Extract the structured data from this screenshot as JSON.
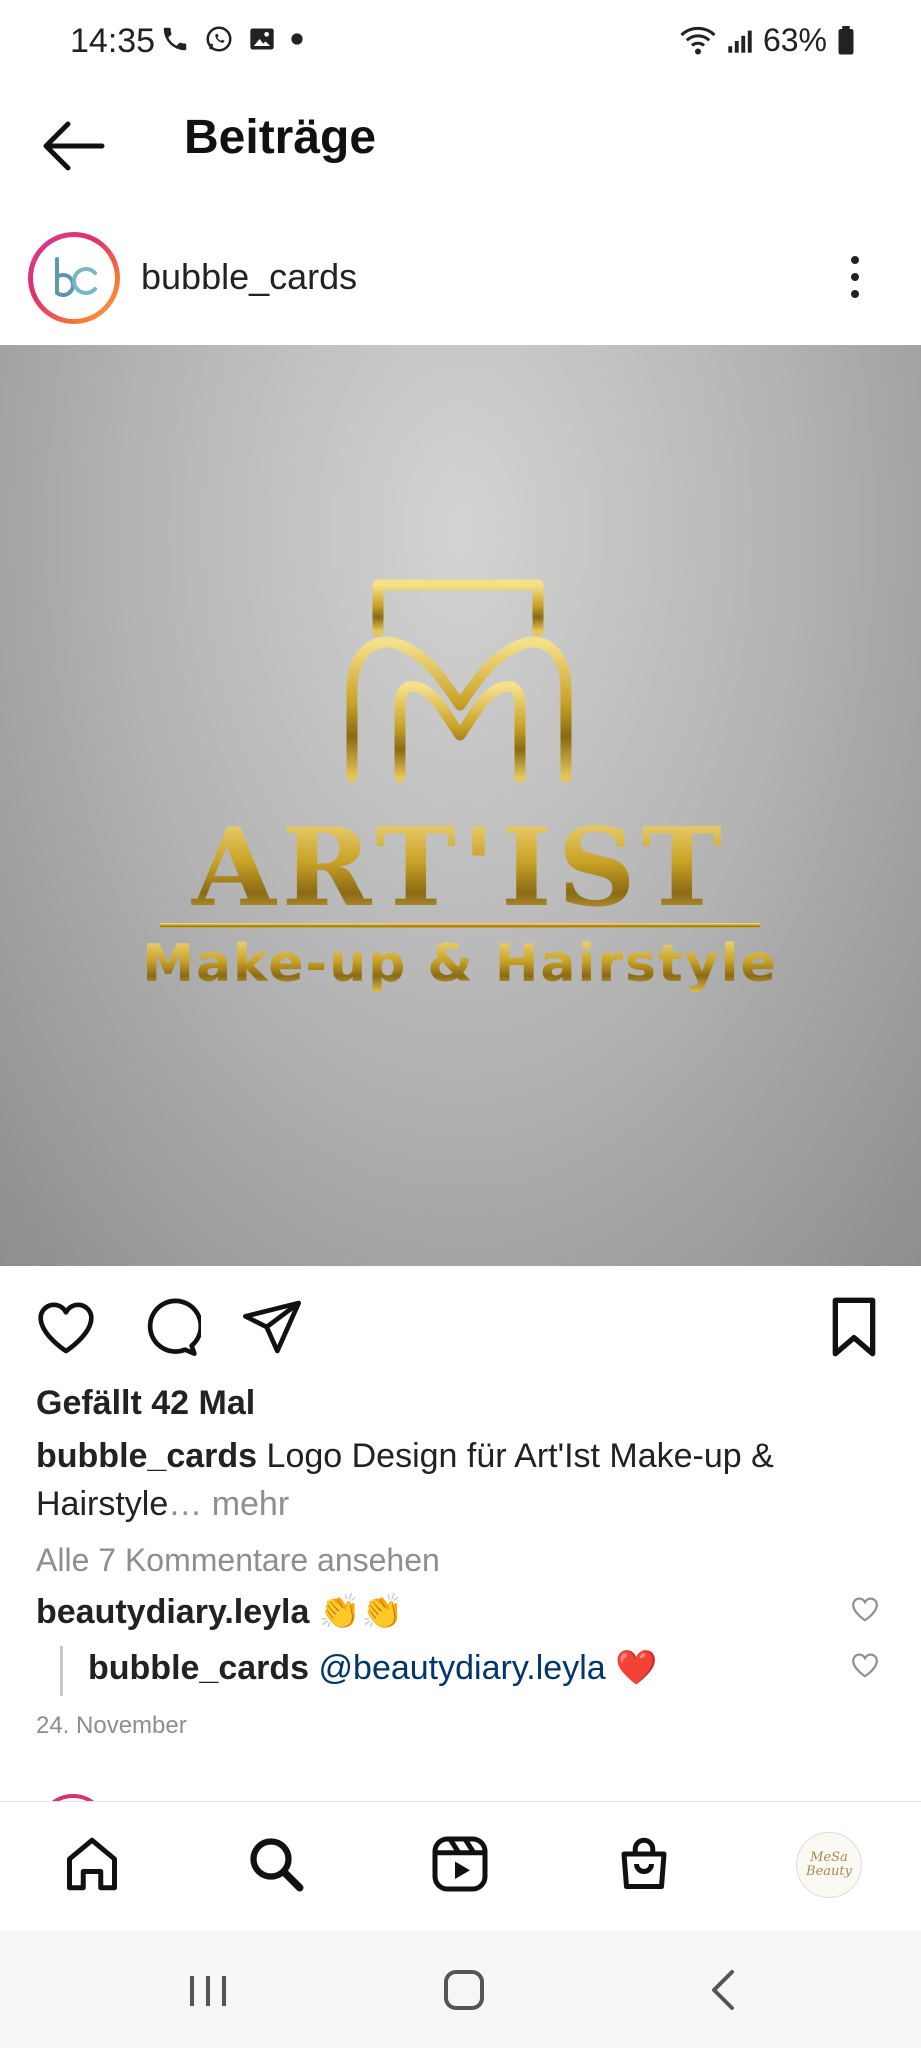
{
  "status_bar": {
    "time": "14:35",
    "battery": "63%"
  },
  "header": {
    "title": "Beiträge"
  },
  "post": {
    "username": "bubble_cards",
    "avatar_initials": "bc",
    "image_logo": {
      "brand": "ART'IST",
      "tagline": "Make-up & Hairstyle",
      "metal_color": "#c9a227"
    },
    "likes": "Gefällt 42 Mal",
    "caption_user": "bubble_cards",
    "caption_text": "Logo Design für Art'Ist Make-up & Hairstyle",
    "caption_more_ellipsis": "…",
    "caption_more": "mehr",
    "view_comments": "Alle 7 Kommentare ansehen",
    "comments": [
      {
        "user": "beautydiary.leyla",
        "text": "👏👏"
      }
    ],
    "reply": {
      "user": "bubble_cards",
      "mention": "@beautydiary.leyla",
      "text": "❤️"
    },
    "date": "24. November"
  },
  "bottom_nav": {
    "items": [
      "home-icon",
      "search-icon",
      "reels-icon",
      "shop-icon",
      "profile-avatar"
    ],
    "profile_text_1": "MeSa",
    "profile_text_2": "Beauty"
  },
  "colors": {
    "mention": "#00376b",
    "muted": "#8e8e8e",
    "gold": "#c9a227"
  }
}
